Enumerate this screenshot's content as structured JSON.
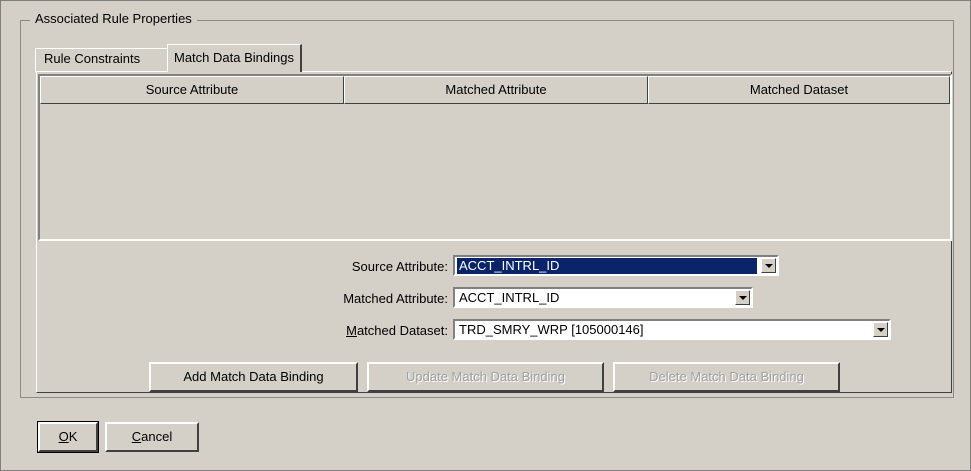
{
  "groupbox": {
    "title": "Associated Rule Properties"
  },
  "tabs": [
    {
      "label": "Rule Constraints",
      "active": false
    },
    {
      "label": "Match Data Bindings",
      "active": true
    }
  ],
  "table": {
    "columns": [
      "Source Attribute",
      "Matched Attribute",
      "Matched Dataset"
    ],
    "rows": []
  },
  "form": {
    "source_attribute": {
      "label": "Source Attribute:",
      "value": "ACCT_INTRL_ID"
    },
    "matched_attribute": {
      "label": "Matched Attribute:",
      "value": "ACCT_INTRL_ID"
    },
    "matched_dataset": {
      "label_mnemonic": "M",
      "label_rest": "atched Dataset:",
      "value": "TRD_SMRY_WRP [105000146]"
    }
  },
  "buttons": {
    "add": "Add Match Data Binding",
    "update": "Update Match Data Binding",
    "delete": "Delete Match Data Binding",
    "ok_mnemonic": "O",
    "ok_rest": "K",
    "cancel_mnemonic": "C",
    "cancel_rest": "ancel"
  },
  "colors": {
    "background": "#d4d0c8",
    "selection": "#0a246a"
  }
}
